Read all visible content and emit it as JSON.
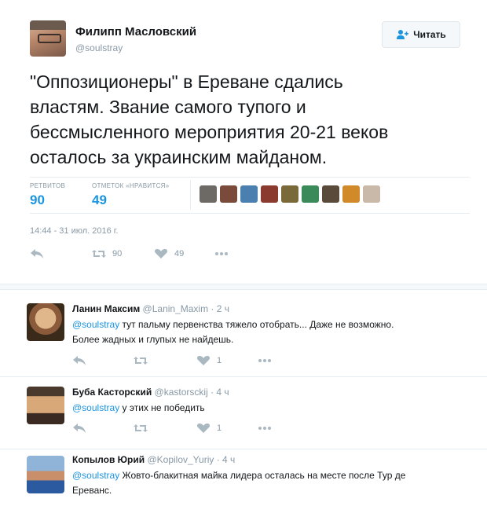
{
  "tweet": {
    "author_name": "Филипп Масловский",
    "author_handle": "@soulstray",
    "follow_label": "Читать",
    "text_lines": [
      "\"Оппозиционеры\" в Ереване сдались",
      "властям. Звание самого тупого и",
      "бессмысленного мероприятия 20-21 веков",
      "осталось за украинским майданом."
    ],
    "retweets_label": "РЕТВИТОВ",
    "retweets": "90",
    "likes_label": "ОТМЕТОК «НРАВИТСЯ»",
    "likes": "49",
    "timestamp": "14:44 - 31 июл. 2016 г.",
    "action_retweets": "90",
    "action_likes": "49",
    "liker_colors": [
      "#6d6a66",
      "#7a4a3a",
      "#4a7fb0",
      "#8a3a2e",
      "#7a6a3a",
      "#3a8a5a",
      "#5a4a3a",
      "#d08a2a",
      "#c9b9a9"
    ]
  },
  "replies": [
    {
      "name": "Ланин Максим",
      "handle": "@Lanin_Maxim · 2 ч",
      "mention": "@soulstray",
      "text_line1": " тут пальму первенства тяжело отобрать... Даже не возможно.",
      "text_line2": "Более жадных и глупых не найдешь.",
      "likes": "1"
    },
    {
      "name": "Буба Касторский",
      "handle": "@kastorsckij · 4 ч",
      "mention": "@soulstray",
      "text_line1": " у этих не победить",
      "likes": "1"
    },
    {
      "name": "Копылов Юрий",
      "handle": "@Kopilov_Yuriy · 4 ч",
      "mention": "@soulstray",
      "text_line1": " Жовто-блакитная майка лидера осталась на месте после Тур де",
      "text_line2": "Ереванс."
    }
  ],
  "colors": {
    "accent": "#1b95e0",
    "muted": "#8899a6",
    "icon": "#aab8c2"
  }
}
